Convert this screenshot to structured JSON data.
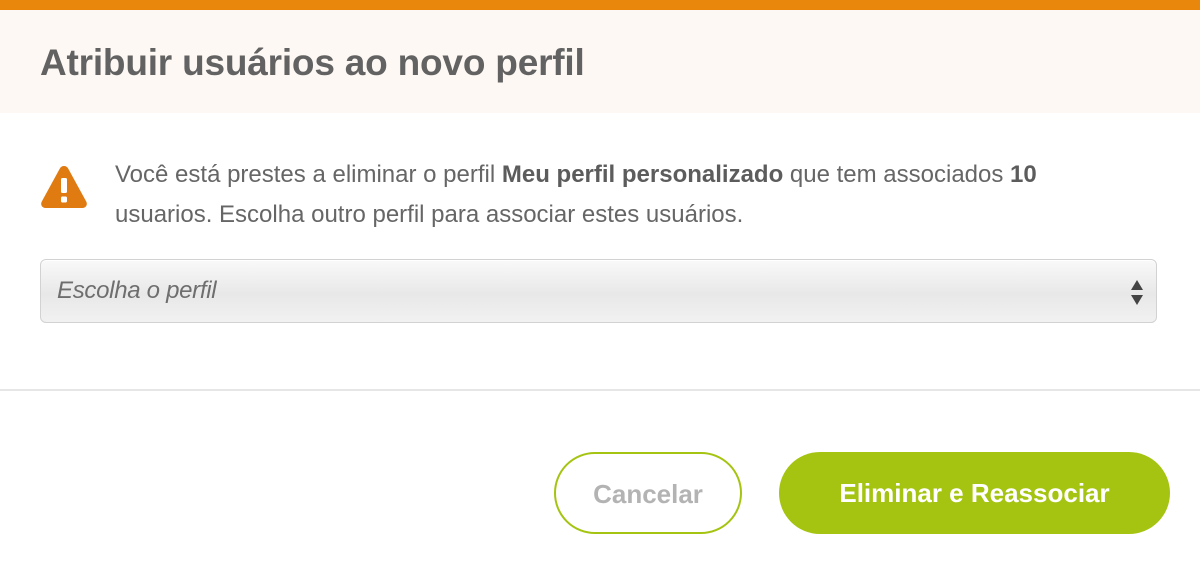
{
  "colors": {
    "accent_bar": "#e8870c",
    "header_bg": "#fdf8f4",
    "warning": "#e07b12",
    "primary_button": "#a4c411"
  },
  "dialog": {
    "title": "Atribuir usuários ao novo perfil"
  },
  "warning": {
    "icon": "warning-triangle-icon",
    "text_before_profile": "Você está prestes a eliminar o perfil ",
    "profile_name": "Meu perfil personalizado",
    "text_after_profile": " que tem associados ",
    "user_count": "10",
    "text_end": " usuarios. Escolha outro perfil para associar estes usuários."
  },
  "profile_select": {
    "placeholder": "Escolha o perfil",
    "icon": "select-arrows-icon"
  },
  "footer": {
    "cancel_label": "Cancelar",
    "confirm_label": "Eliminar e Reassociar"
  }
}
